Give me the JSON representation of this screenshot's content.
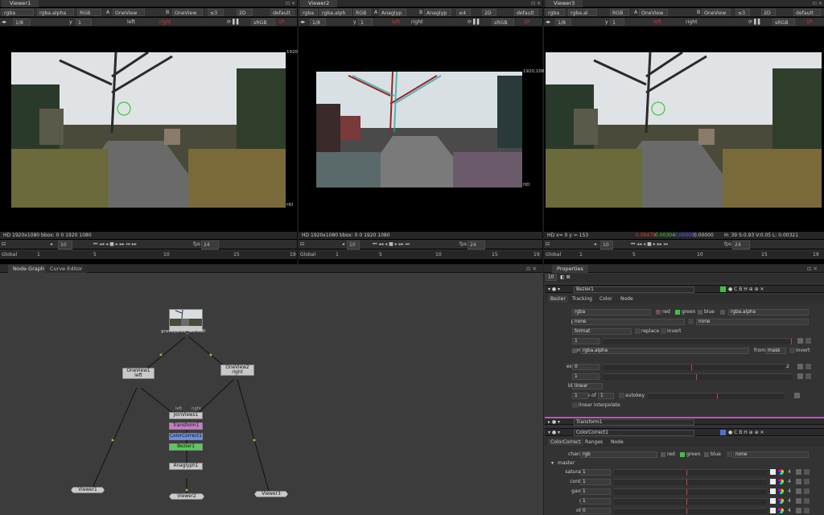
{
  "viewers": [
    {
      "tab": "Viewer1",
      "layer": "rgba",
      "alpha": "rgba.alpha",
      "channels": "RGB",
      "a_input": "OneView",
      "b_input": "OneView",
      "zoom": "≤3",
      "mode": "2D",
      "lut": "default",
      "frame_step": "1/8",
      "y_val": "1",
      "view_left": "left",
      "view_right": "right",
      "colorspace": "sRGB",
      "proxy": "1P",
      "format_info": "HD 1920x1080 bbox: 0 0 1920 1080",
      "res_label": "1920",
      "hd_label": "HD",
      "fps_label": "fps",
      "fps": "24",
      "range": "Global",
      "skip": "10",
      "ticks": [
        "1",
        "5",
        "10",
        "15",
        "19"
      ]
    },
    {
      "tab": "Viewer2",
      "layer": "rgba",
      "alpha": "rgba.alph",
      "channels": "RGB",
      "a_input": "Anaglyp",
      "b_input": "Anaglyp",
      "zoom": "≤4",
      "mode": "2D",
      "lut": "default",
      "frame_step": "1/8",
      "y_val": "1",
      "view_left": "left",
      "view_right": "right",
      "colorspace": "sRGB",
      "proxy": "1P",
      "format_info": "HD 1920x1080 bbox: 0 0 1920 1080",
      "res_label": "1920,108",
      "hd_label": "HD",
      "fps_label": "fps",
      "fps": "24",
      "range": "Global",
      "skip": "10",
      "ticks": [
        "1",
        "5",
        "10",
        "15",
        "19"
      ]
    },
    {
      "tab": "Viewer3",
      "layer": "rgba",
      "alpha": "rgba.al",
      "channels": "RGB",
      "a_input": "OneView",
      "b_input": "OneView",
      "zoom": "≤3",
      "mode": "2D",
      "lut": "default",
      "frame_step": "1/8",
      "y_val": "1",
      "view_left": "left",
      "view_right": "right",
      "colorspace": "sRGB",
      "proxy": "1P",
      "format_info": "HD   x=  0 y = 153",
      "res_label": "",
      "hd_label": "",
      "fps_label": "fps",
      "fps": "24",
      "range": "Global",
      "skip": "10",
      "ticks": [
        "1",
        "5",
        "10",
        "15",
        "19"
      ],
      "pixel_r": "0.00478",
      "pixel_g": "0.00304",
      "pixel_b": "0.00000",
      "pixel_a": "0.00000",
      "hsv": "H: 39 S:0.93 V:0.05  L: 0.00321"
    }
  ],
  "node_graph": {
    "tabs": [
      "Node Graph",
      "Curve Editor"
    ],
    "nodes": {
      "read": "graveyard1_left.000",
      "oneview1": "OneView1\nleft",
      "oneview2": "OneView2\nright",
      "joinviews": "JoinViews1",
      "transform": "Transform1",
      "colorcorrect": "ColorCorrect1",
      "bezier": "Bezier1",
      "anaglyph": "Anaglyph1",
      "viewer1": "Viewer1",
      "viewer2": "Viewer2",
      "viewer3": "Viewer3",
      "left_label": "left",
      "right_label": "right"
    },
    "colors": {
      "transform": "#c87ac8",
      "colorcorrect": "#6a8ee0",
      "bezier": "#5ac85a"
    }
  },
  "properties": {
    "title": "Properties",
    "count": "10",
    "bezier": {
      "name": "Bezier1",
      "tabs": [
        "Bezier",
        "Tracking",
        "Color",
        "Node"
      ],
      "output": "rgba",
      "out_red": "red",
      "out_green": "green",
      "out_blue": "blue",
      "out_alpha": "rgba.alpha",
      "premult": "none",
      "premult2": "none",
      "clip_to": "format",
      "replace": "replace",
      "invert": "invert",
      "opacity": "1",
      "mask": "rgba.alpha",
      "from": "from",
      "mask_from": "mask",
      "mask_invert": "invert",
      "extra_blur": "0",
      "extra_blur_max": "2",
      "falloff": "1",
      "blur_type": "linear",
      "shape": "1",
      "of": "of",
      "shape_of": "1",
      "autokey": "autokey",
      "linear_interpolate": "linear interpolate",
      "labels": {
        "output": "output",
        "premult": "premult",
        "clip_to": "clip to",
        "opacity": "opacity",
        "mask": "mask",
        "extra_blur": "extra blur",
        "falloff": "falloff",
        "blur_type": "blur type",
        "shape": "shape"
      }
    },
    "transform": {
      "name": "Transform1"
    },
    "colorcorrect": {
      "name": "ColorCorrect1",
      "tabs": [
        "ColorCorrect",
        "Ranges",
        "Node"
      ],
      "channels": "rgb",
      "ch_red": "red",
      "ch_green": "green",
      "ch_blue": "blue",
      "ch_none": "none",
      "section": "master",
      "rows": [
        {
          "label": "saturation",
          "value": "1"
        },
        {
          "label": "contrast",
          "value": "1"
        },
        {
          "label": "gamma",
          "value": "1"
        },
        {
          "label": "gain",
          "value": "1"
        },
        {
          "label": "offset",
          "value": "0"
        }
      ],
      "channels_label": "channels",
      "row_num": "4"
    }
  }
}
